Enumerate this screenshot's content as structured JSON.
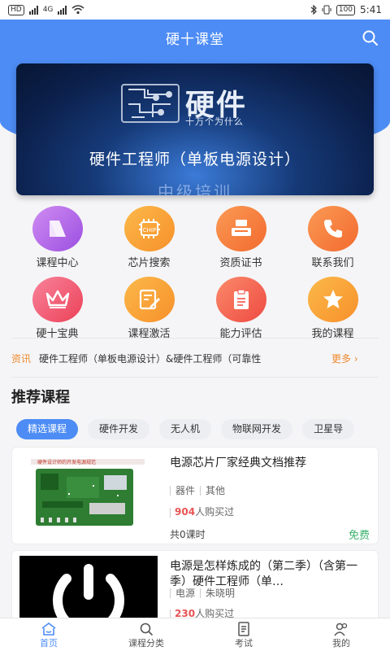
{
  "status_bar": {
    "network_left": "HD",
    "network_mid": "4G",
    "battery": "100",
    "time": "5:41"
  },
  "header": {
    "title": "硬十课堂"
  },
  "banner": {
    "logo_text": "硬件",
    "logo_sub": "十万个为什么",
    "title": "硬件工程师（单板电源设计）",
    "bottom_text": "中级培训"
  },
  "grid": [
    {
      "label": "课程中心",
      "icon": "course-center-icon",
      "color": "#b96bea"
    },
    {
      "label": "芯片搜索",
      "icon": "chip-search-icon",
      "chip_text": "CHIP",
      "color": "#f9a12e"
    },
    {
      "label": "资质证书",
      "icon": "certificate-icon",
      "color": "#f7793b"
    },
    {
      "label": "联系我们",
      "icon": "phone-icon",
      "color": "#f7793b"
    },
    {
      "label": "硬十宝典",
      "icon": "crown-icon",
      "color": "#f0596b"
    },
    {
      "label": "课程激活",
      "icon": "activate-icon",
      "color": "#f9a12e"
    },
    {
      "label": "能力评估",
      "icon": "assessment-icon",
      "color": "#f5625a"
    },
    {
      "label": "我的课程",
      "icon": "star-icon",
      "color": "#f9a12e"
    }
  ],
  "news": {
    "tag": "资讯",
    "text": "硬件工程师（单板电源设计）&硬件工程师（可靠性",
    "more": "更多 ›"
  },
  "recommend": {
    "title": "推荐课程"
  },
  "chips": [
    "精选课程",
    "硬件开发",
    "无人机",
    "物联网开发",
    "卫星导"
  ],
  "courses": [
    {
      "title": "电源芯片厂家经典文档推荐",
      "tag1": "器件",
      "tag2": "其他",
      "buyers": "904",
      "buyers_suffix": "人购买过",
      "lessons": "共0课时",
      "price": "免费",
      "thumb_caption": "硬件设计师的开发电源规范"
    },
    {
      "title": "电源是怎样炼成的（第二季）（含第一季）硬件工程师（单…",
      "tag1": "电源",
      "tag2": "朱晓明",
      "buyers": "230",
      "buyers_suffix": "人购买过"
    }
  ],
  "tabbar": [
    {
      "label": "首页",
      "icon": "home-icon"
    },
    {
      "label": "课程分类",
      "icon": "search-icon"
    },
    {
      "label": "考试",
      "icon": "document-icon"
    },
    {
      "label": "我的",
      "icon": "user-icon"
    }
  ],
  "colors": {
    "primary": "#4d8cf5",
    "accent_orange": "#f08a2e",
    "free_green": "#3bb36e",
    "buyers_red": "#e85454"
  }
}
